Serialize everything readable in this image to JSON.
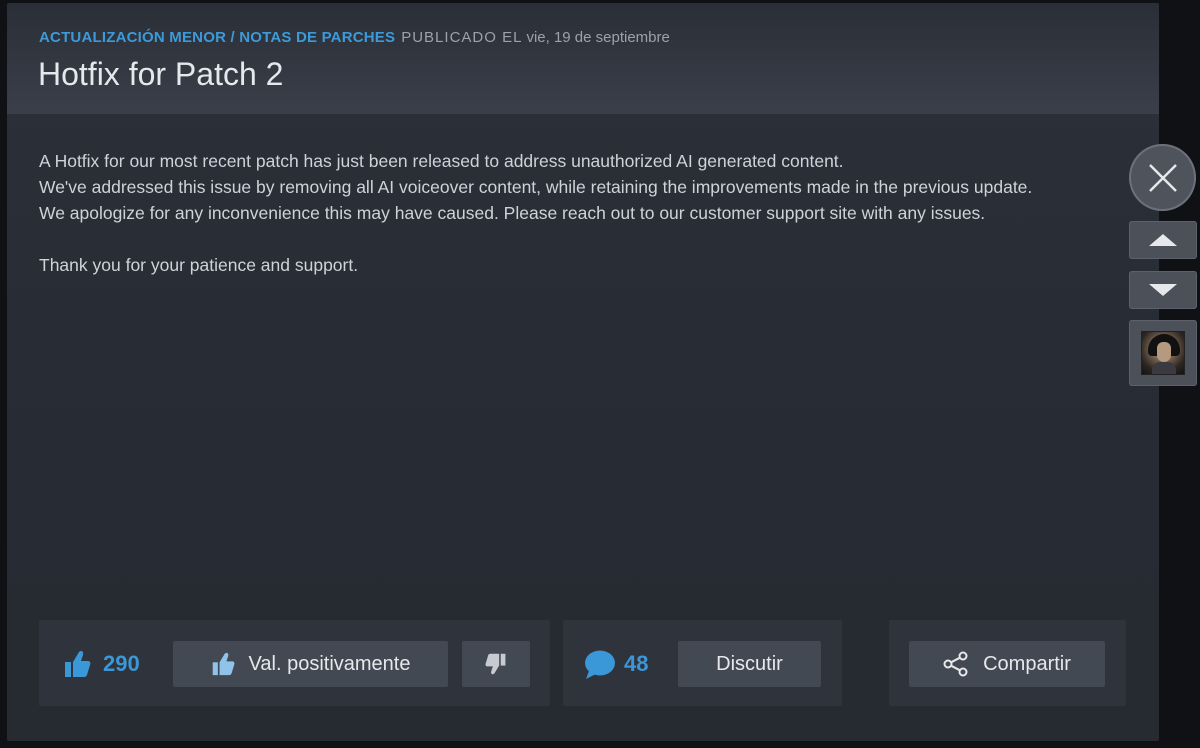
{
  "post": {
    "category": "ACTUALIZACIÓN MENOR / NOTAS DE PARCHES",
    "published_label": "PUBLICADO EL",
    "date": "vie, 19 de septiembre",
    "title": "Hotfix for Patch 2",
    "paragraphs": [
      "A Hotfix for our most recent patch has just been released to address unauthorized AI generated content.",
      "We've addressed this issue by removing all AI voiceover content, while retaining the improvements made in the previous update.",
      "We apologize for any inconvenience this may have caused. Please reach out to our customer support site with any issues.",
      "Thank you for your patience and support."
    ]
  },
  "footer": {
    "likes_count": "290",
    "like_button_label": "Val. positivamente",
    "comments_count": "48",
    "discuss_button_label": "Discutir",
    "share_button_label": "Compartir"
  },
  "colors": {
    "accent": "#3d9ad9",
    "background": "#0f1114",
    "panel": "#2a2e37",
    "button": "#434953"
  },
  "icons": {
    "like": "thumbs-up-icon",
    "dislike": "thumbs-down-icon",
    "comment": "speech-bubble-icon",
    "share": "share-icon",
    "close": "close-icon",
    "scroll_up": "arrow-up-icon",
    "scroll_down": "arrow-down-icon"
  }
}
